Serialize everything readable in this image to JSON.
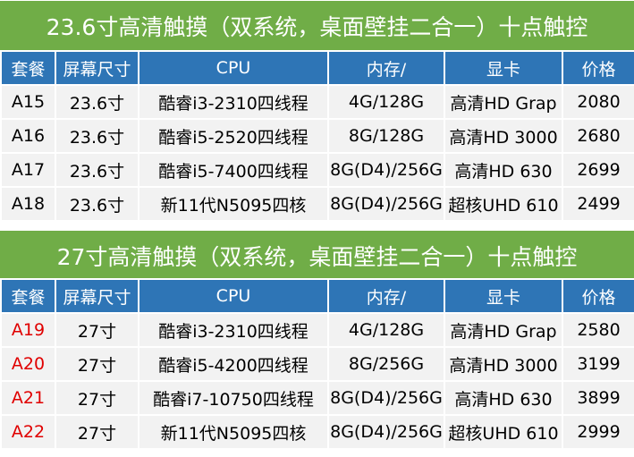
{
  "section1": {
    "title": "23.6寸高清触摸（双系统，桌面壁挂二合一）十点触控",
    "headers": [
      "套餐",
      "屏幕尺寸",
      "CPU",
      "内存/",
      "显卡",
      "价格"
    ],
    "rows": [
      [
        "A15",
        "23.6寸",
        "酷睿i3-2310四线程",
        "4G/128G",
        "高清HD Grap",
        "2080"
      ],
      [
        "A16",
        "23.6寸",
        "酷睿i5-2520四线程",
        "8G/128G",
        "高清HD 3000",
        "2680"
      ],
      [
        "A17",
        "23.6寸",
        "酷睿i5-7400四线程",
        "8G(D4)/256G",
        "高清HD 630",
        "2699"
      ],
      [
        "A18",
        "23.6寸",
        "新11代N5095四核",
        "8G(D4)/256G",
        "超核UHD 610",
        "2499"
      ]
    ]
  },
  "section2": {
    "title": "27寸高清触摸（双系统，桌面壁挂二合一）十点触控",
    "headers": [
      "套餐",
      "屏幕尺寸",
      "CPU",
      "内存/",
      "显卡",
      "价格"
    ],
    "rows": [
      [
        "A19",
        "27寸",
        "酷睿i3-2310四线程",
        "4G/128G",
        "高清HD Grap",
        "2580"
      ],
      [
        "A20",
        "27寸",
        "酷睿i5-4200四线程",
        "8G/256G",
        "高清HD 3000",
        "3199"
      ],
      [
        "A21",
        "27寸",
        "酷睿i7-10750四线程",
        "8G(D4)/256G",
        "高清HD 630",
        "3899"
      ],
      [
        "A22",
        "27寸",
        "新11代N5095四核",
        "8G(D4)/256G",
        "超核UHD 610",
        "2999"
      ]
    ]
  },
  "colors": {
    "title_bg": "#70ad47",
    "header_bg": "#2e75b6",
    "row_bg": "#f2f2f2",
    "highlight_code": "#e00000"
  }
}
